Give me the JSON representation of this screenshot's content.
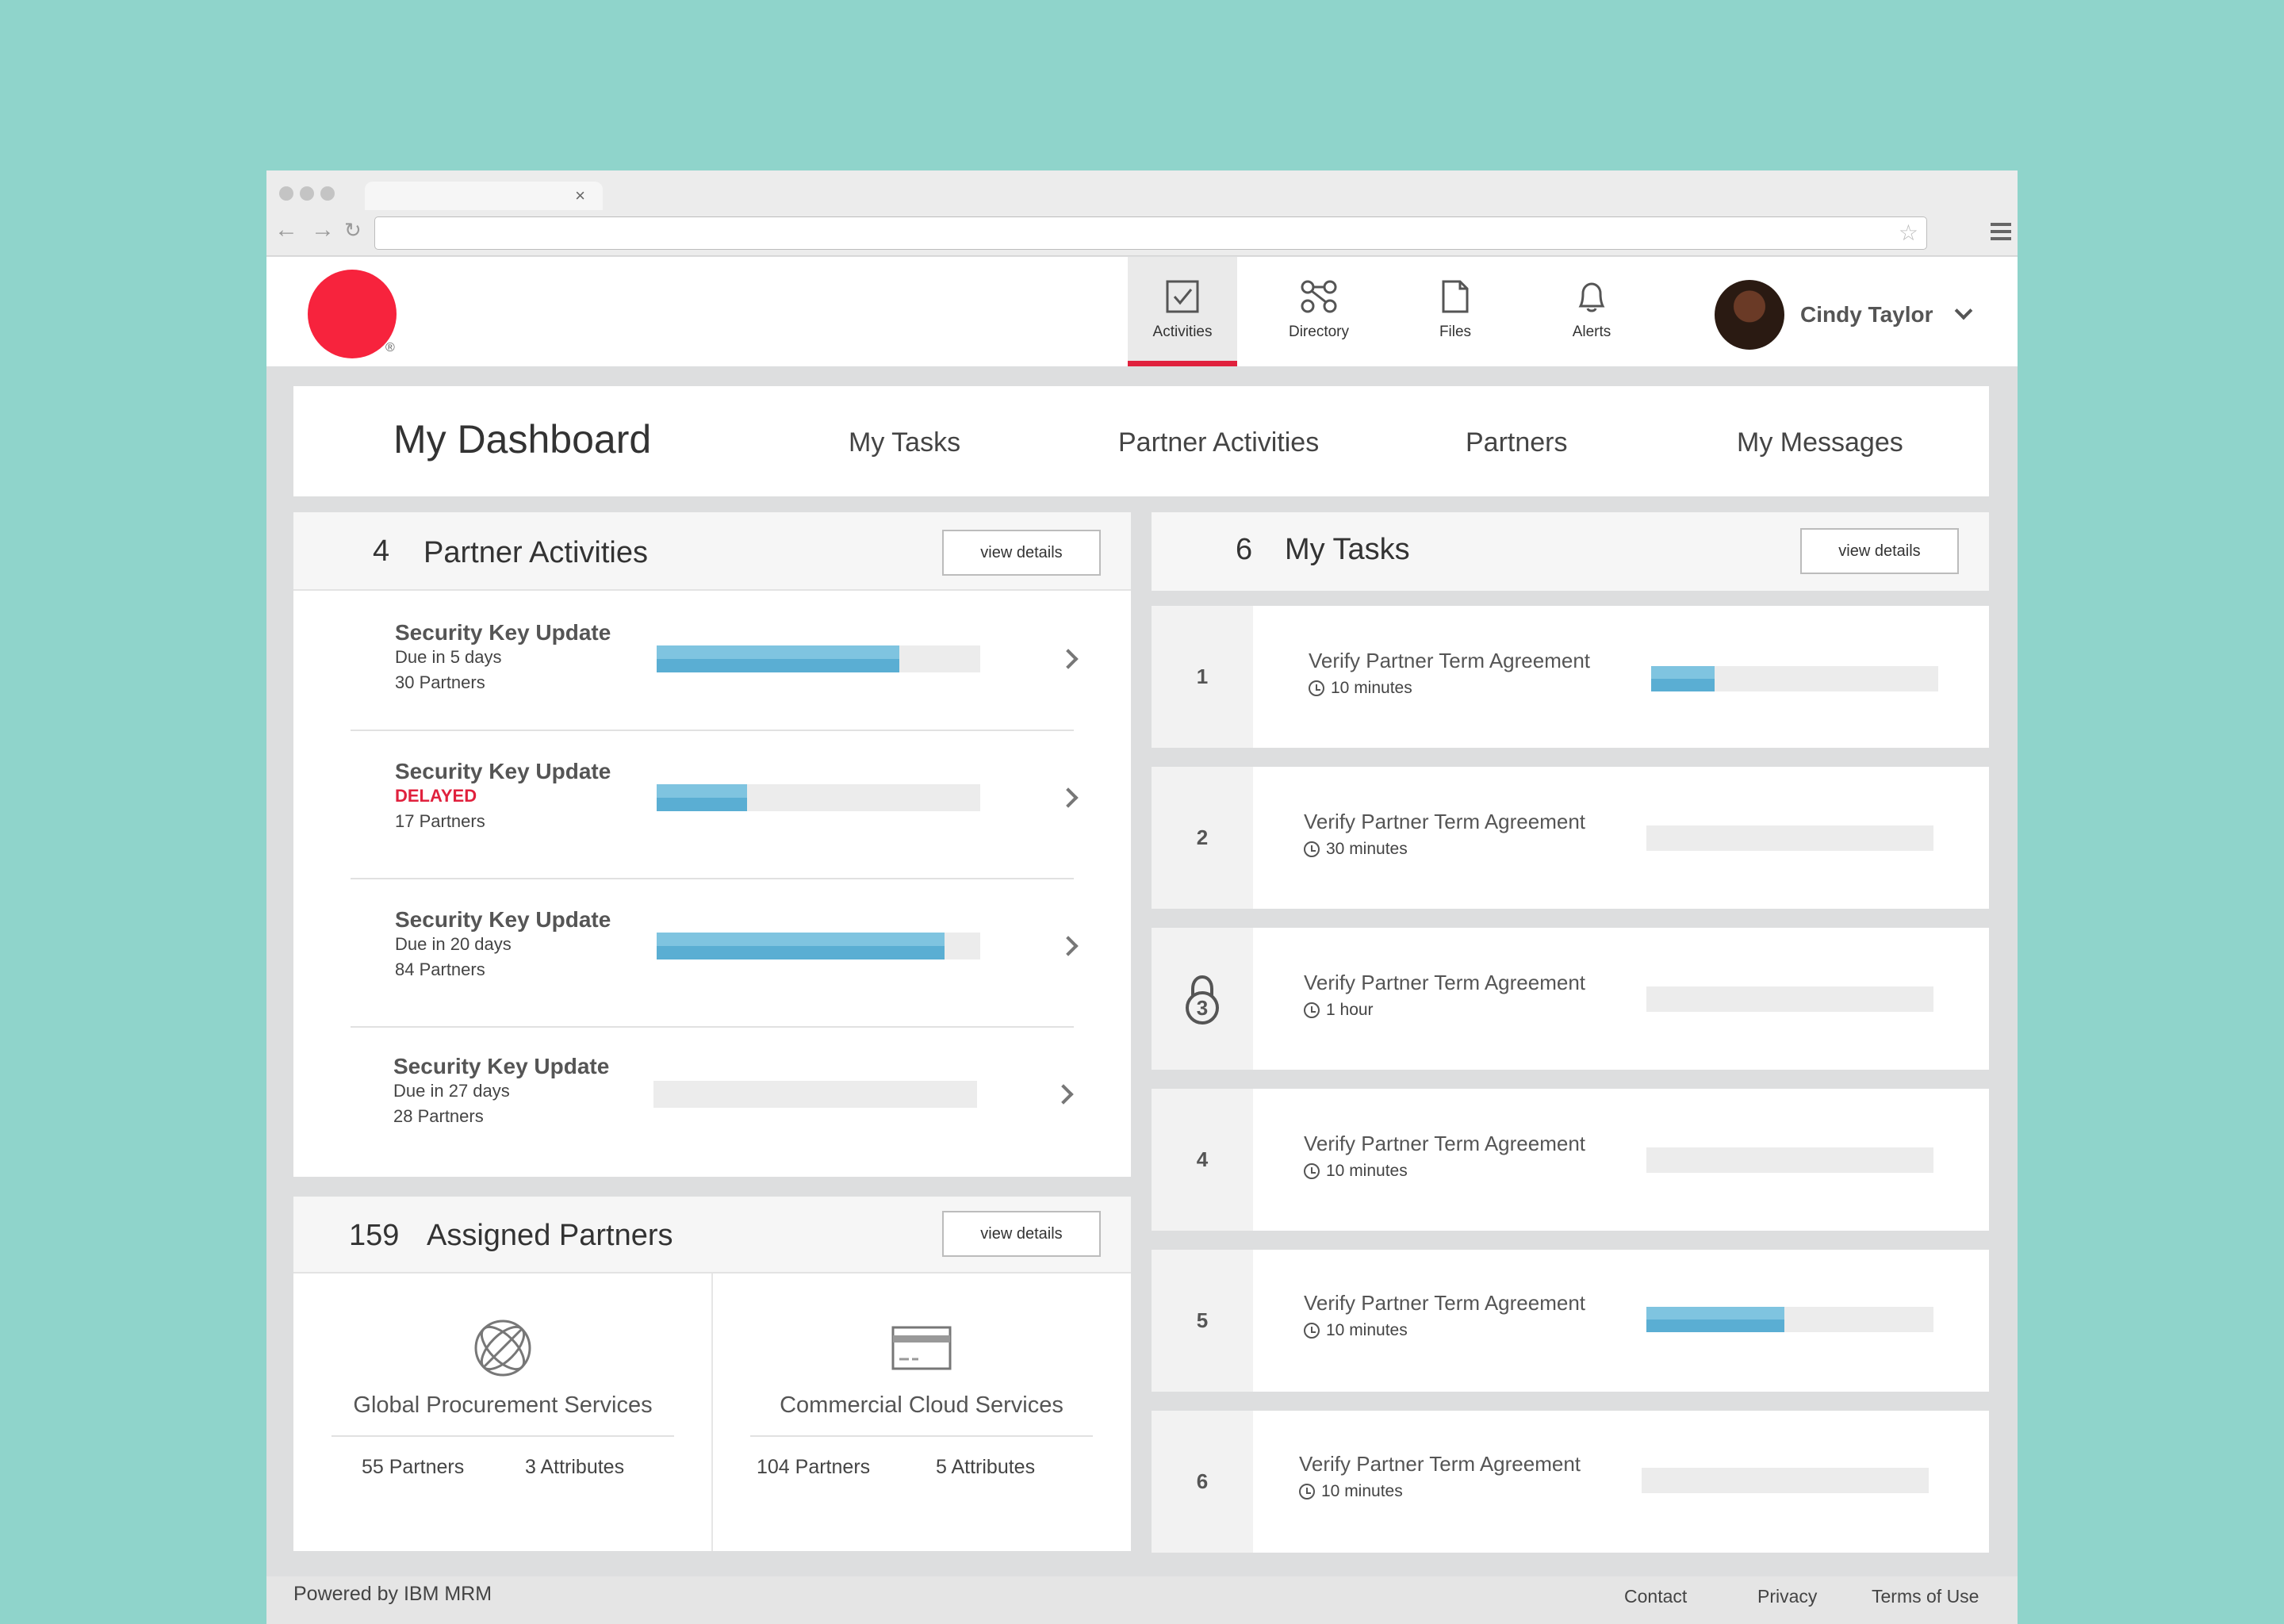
{
  "browser": {
    "tab_close": "×",
    "back": "←",
    "forward": "→",
    "reload": "↻",
    "star": "☆"
  },
  "app": {
    "logo_reg": "®",
    "nav": [
      {
        "label": "Activities",
        "icon": "activities-icon"
      },
      {
        "label": "Directory",
        "icon": "directory-icon"
      },
      {
        "label": "Files",
        "icon": "file-icon"
      },
      {
        "label": "Alerts",
        "icon": "bell-icon"
      }
    ],
    "user": {
      "name": "Cindy Taylor"
    }
  },
  "tabs": {
    "title": "My Dashboard",
    "links": [
      "My Tasks",
      "Partner Activities",
      "Partners",
      "My Messages"
    ]
  },
  "partner_activities": {
    "count": "4",
    "title": "Partner Activities",
    "view_details": "view details",
    "items": [
      {
        "name": "Security Key Update",
        "status": "Due in 5 days",
        "partners": "30 Partners",
        "progress": 0.75
      },
      {
        "name": "Security Key Update",
        "status": "DELAYED",
        "partners": "17 Partners",
        "progress": 0.28
      },
      {
        "name": "Security Key Update",
        "status": "Due in 20 days",
        "partners": "84 Partners",
        "progress": 0.89
      },
      {
        "name": "Security Key Update",
        "status": "Due in 27 days",
        "partners": "28 Partners",
        "progress": 0.0
      }
    ]
  },
  "assigned_partners": {
    "count": "159",
    "title": "Assigned Partners",
    "view_details": "view details",
    "services": [
      {
        "name": "Global Procurement Services",
        "partners": "55 Partners",
        "attributes": "3 Attributes",
        "icon": "globe-icon"
      },
      {
        "name": "Commercial Cloud Services",
        "partners": "104 Partners",
        "attributes": "5 Attributes",
        "icon": "card-icon"
      }
    ]
  },
  "my_tasks": {
    "count": "6",
    "title": "My Tasks",
    "view_details": "view details",
    "items": [
      {
        "num": "1",
        "name": "Verify Partner Term Agreement",
        "time": "10 minutes",
        "progress": 0.22
      },
      {
        "num": "2",
        "name": "Verify Partner Term Agreement",
        "time": "30 minutes",
        "progress": 0.0
      },
      {
        "num": "3",
        "name": "Verify Partner Term Agreement",
        "time": "1 hour",
        "progress": 0.0,
        "locked": true
      },
      {
        "num": "4",
        "name": "Verify Partner Term Agreement",
        "time": "10 minutes",
        "progress": 0.0
      },
      {
        "num": "5",
        "name": "Verify Partner Term Agreement",
        "time": "10 minutes",
        "progress": 0.48
      },
      {
        "num": "6",
        "name": "Verify Partner Term Agreement",
        "time": "10 minutes",
        "progress": 0.0
      }
    ]
  },
  "footer": {
    "powered": "Powered by IBM MRM",
    "links": [
      "Contact",
      "Privacy",
      "Terms of Use"
    ]
  },
  "colors": {
    "accent": "#e0213d",
    "progress": "#5aaed3",
    "background": "#8fd4cb"
  }
}
